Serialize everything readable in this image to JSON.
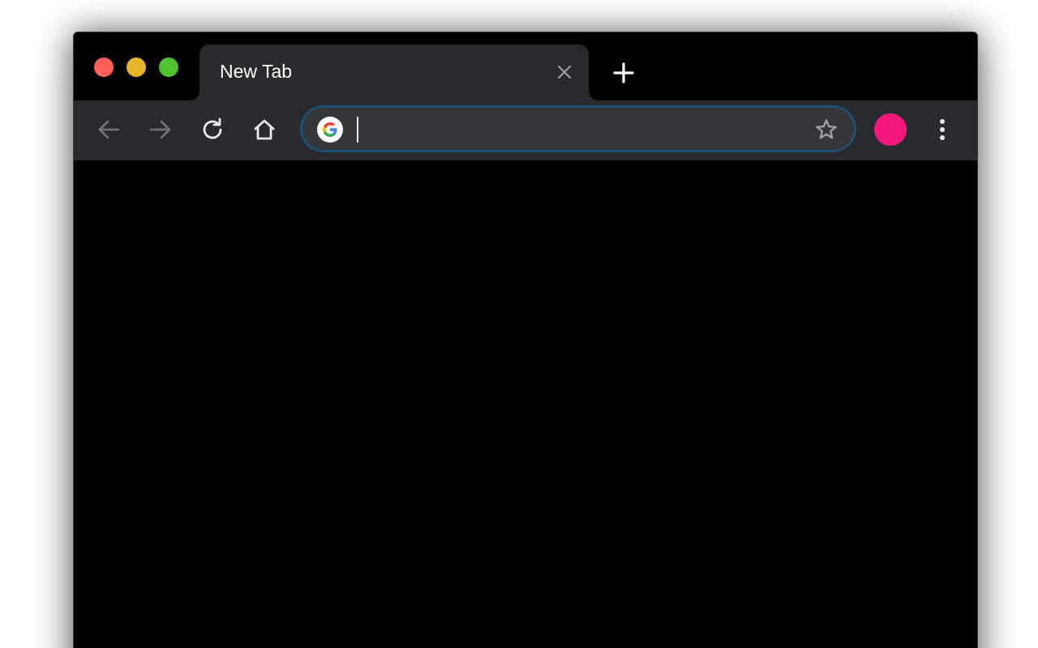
{
  "window": {
    "controls": {
      "close_color": "#fe5f57",
      "minimize_color": "#e6b52b",
      "maximize_color": "#4fc22f"
    }
  },
  "tabs": [
    {
      "title": "New Tab",
      "active": true,
      "close_icon": "close-icon"
    }
  ],
  "new_tab_icon": "plus-icon",
  "toolbar": {
    "back_icon": "arrow-left-icon",
    "forward_icon": "arrow-right-icon",
    "reload_icon": "reload-icon",
    "home_icon": "home-icon",
    "omnibox": {
      "value": "",
      "placeholder": "",
      "leading_icon": "google-icon",
      "trailing_icon": "star-icon",
      "focused": true,
      "focus_color": "#1f4f75"
    },
    "avatar_color": "#f2177f",
    "menu_icon": "kebab-menu-icon"
  },
  "colors": {
    "titlebar_bg": "#000000",
    "toolbar_bg": "#292a2d",
    "omnibox_bg": "#35363a",
    "content_bg": "#000000"
  }
}
